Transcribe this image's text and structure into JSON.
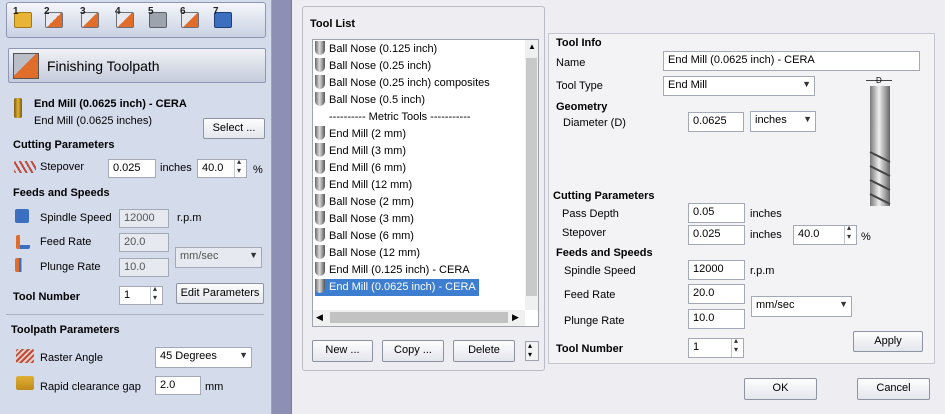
{
  "toolbar": {
    "buttons": [
      {
        "num": "1",
        "icon": "folder-icon"
      },
      {
        "num": "2",
        "icon": "load-toolpath-icon"
      },
      {
        "num": "3",
        "icon": "strategy3-icon"
      },
      {
        "num": "4",
        "icon": "strategy4-icon"
      },
      {
        "num": "5",
        "icon": "strategy5-icon"
      },
      {
        "num": "6",
        "icon": "strategy6-icon"
      },
      {
        "num": "7",
        "icon": "save-icon"
      }
    ]
  },
  "panel": {
    "title": "Finishing Toolpath",
    "tool": {
      "name": "End Mill (0.0625 inch) - CERA",
      "sub": "End Mill (0.0625 inches)",
      "select_label": "Select ..."
    },
    "cutting": {
      "heading": "Cutting Parameters",
      "stepover_label": "Stepover",
      "stepover_value": "0.025",
      "stepover_unit": "inches",
      "percent_value": "40.0",
      "percent_unit": "%"
    },
    "feeds": {
      "heading": "Feeds and Speeds",
      "spindle_label": "Spindle Speed",
      "spindle_value": "12000",
      "spindle_unit": "r.p.m",
      "feed_label": "Feed Rate",
      "feed_value": "20.0",
      "plunge_label": "Plunge Rate",
      "plunge_value": "10.0",
      "rate_unit": "mm/sec"
    },
    "tool_number": {
      "label": "Tool Number",
      "value": "1",
      "edit_label": "Edit Parameters"
    },
    "toolpath": {
      "heading": "Toolpath Parameters",
      "raster_label": "Raster Angle",
      "raster_value": "45 Degrees",
      "clearance_label": "Rapid clearance gap",
      "clearance_value": "2.0",
      "clearance_unit": "mm"
    }
  },
  "dialog": {
    "tool_list_label": "Tool List",
    "tools": [
      "Ball Nose (0.125 inch)",
      "Ball Nose (0.25 inch)",
      "Ball Nose (0.25 inch) composites",
      "Ball Nose (0.5 inch)",
      "---------- Metric Tools -----------",
      "End Mill (2 mm)",
      "End Mill (3 mm)",
      "End Mill (6 mm)",
      "End Mill (12 mm)",
      "Ball Nose (2 mm)",
      "Ball Nose (3 mm)",
      "Ball Nose (6 mm)",
      "Ball Nose (12 mm)",
      "End Mill (0.125 inch) - CERA",
      "End Mill (0.0625 inch) - CERA"
    ],
    "selected_index": 14,
    "new_label": "New ...",
    "copy_label": "Copy ...",
    "delete_label": "Delete",
    "info": {
      "heading": "Tool Info",
      "name_label": "Name",
      "name_value": "End Mill (0.0625 inch) - CERA",
      "type_label": "Tool Type",
      "type_value": "End Mill",
      "geometry_heading": "Geometry",
      "diameter_label": "Diameter (D)",
      "diameter_value": "0.0625",
      "diameter_unit": "inches",
      "diagram_label": "D",
      "cutting_heading": "Cutting Parameters",
      "pass_label": "Pass Depth",
      "pass_value": "0.05",
      "pass_unit": "inches",
      "stepover_label": "Stepover",
      "stepover_value": "0.025",
      "stepover_unit": "inches",
      "stepover_pct": "40.0",
      "pct_unit": "%",
      "feeds_heading": "Feeds and Speeds",
      "spindle_label": "Spindle Speed",
      "spindle_value": "12000",
      "spindle_unit": "r.p.m",
      "feed_label": "Feed Rate",
      "feed_value": "20.0",
      "rate_unit": "mm/sec",
      "plunge_label": "Plunge Rate",
      "plunge_value": "10.0",
      "toolnum_label": "Tool Number",
      "toolnum_value": "1",
      "apply_label": "Apply"
    },
    "ok_label": "OK",
    "cancel_label": "Cancel"
  }
}
